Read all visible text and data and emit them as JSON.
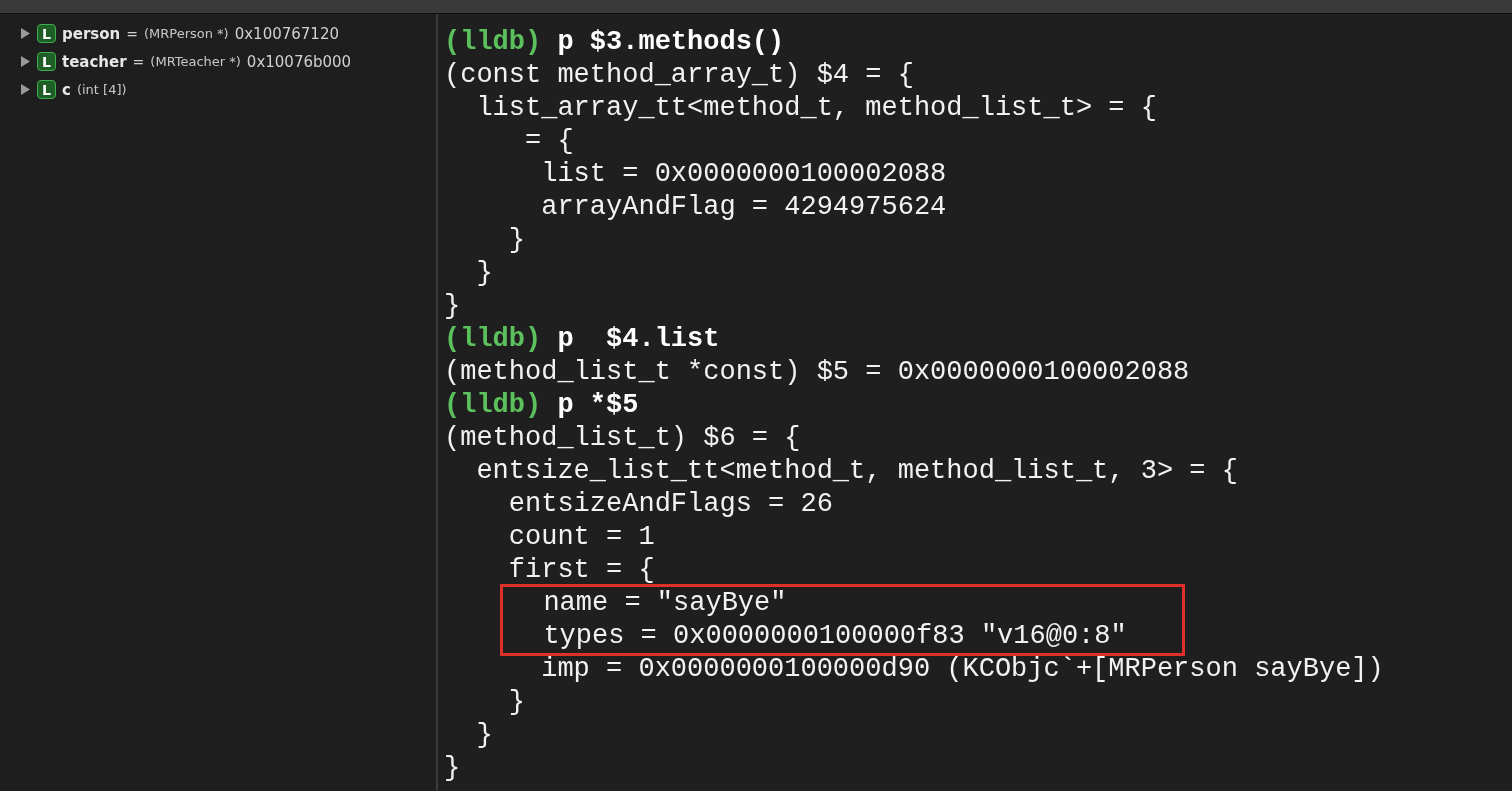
{
  "variables": [
    {
      "badge": "L",
      "name": "person",
      "separator": "=",
      "type": "(MRPerson *)",
      "value": "0x100767120",
      "expanded": false
    },
    {
      "badge": "L",
      "name": "teacher",
      "separator": "=",
      "type": "(MRTeacher *)",
      "value": "0x10076b000",
      "expanded": false
    },
    {
      "badge": "L",
      "name": "c",
      "type": "(int [4])",
      "expanded": false
    }
  ],
  "console": [
    {
      "kind": "prompt",
      "prompt": "(lldb)",
      "command": "p $3.methods()"
    },
    {
      "kind": "output",
      "text": "(const method_array_t) $4 = {"
    },
    {
      "kind": "output",
      "text": "  list_array_tt<method_t, method_list_t> = {"
    },
    {
      "kind": "output",
      "text": "     = {"
    },
    {
      "kind": "output",
      "text": "      list = 0x0000000100002088"
    },
    {
      "kind": "output",
      "text": "      arrayAndFlag = 4294975624"
    },
    {
      "kind": "output",
      "text": "    }"
    },
    {
      "kind": "output",
      "text": "  }"
    },
    {
      "kind": "output",
      "text": "}"
    },
    {
      "kind": "prompt",
      "prompt": "(lldb)",
      "command": "p  $4.list"
    },
    {
      "kind": "output",
      "text": "(method_list_t *const) $5 = 0x0000000100002088"
    },
    {
      "kind": "prompt",
      "prompt": "(lldb)",
      "command": "p *$5"
    },
    {
      "kind": "output",
      "text": "(method_list_t) $6 = {"
    },
    {
      "kind": "output",
      "text": "  entsize_list_tt<method_t, method_list_t, 3> = {"
    },
    {
      "kind": "output",
      "text": "    entsizeAndFlags = 26"
    },
    {
      "kind": "output",
      "text": "    count = 1"
    },
    {
      "kind": "output",
      "text": "    first = {"
    },
    {
      "kind": "highlight",
      "lines": [
        "  name = \"sayBye\"",
        "  types = 0x0000000100000f83 \"v16@0:8\""
      ]
    },
    {
      "kind": "output",
      "text": "      imp = 0x0000000100000d90 (KCObjc`+[MRPerson sayBye])"
    },
    {
      "kind": "output",
      "text": "    }"
    },
    {
      "kind": "output",
      "text": "  }"
    },
    {
      "kind": "output",
      "text": "}"
    }
  ]
}
